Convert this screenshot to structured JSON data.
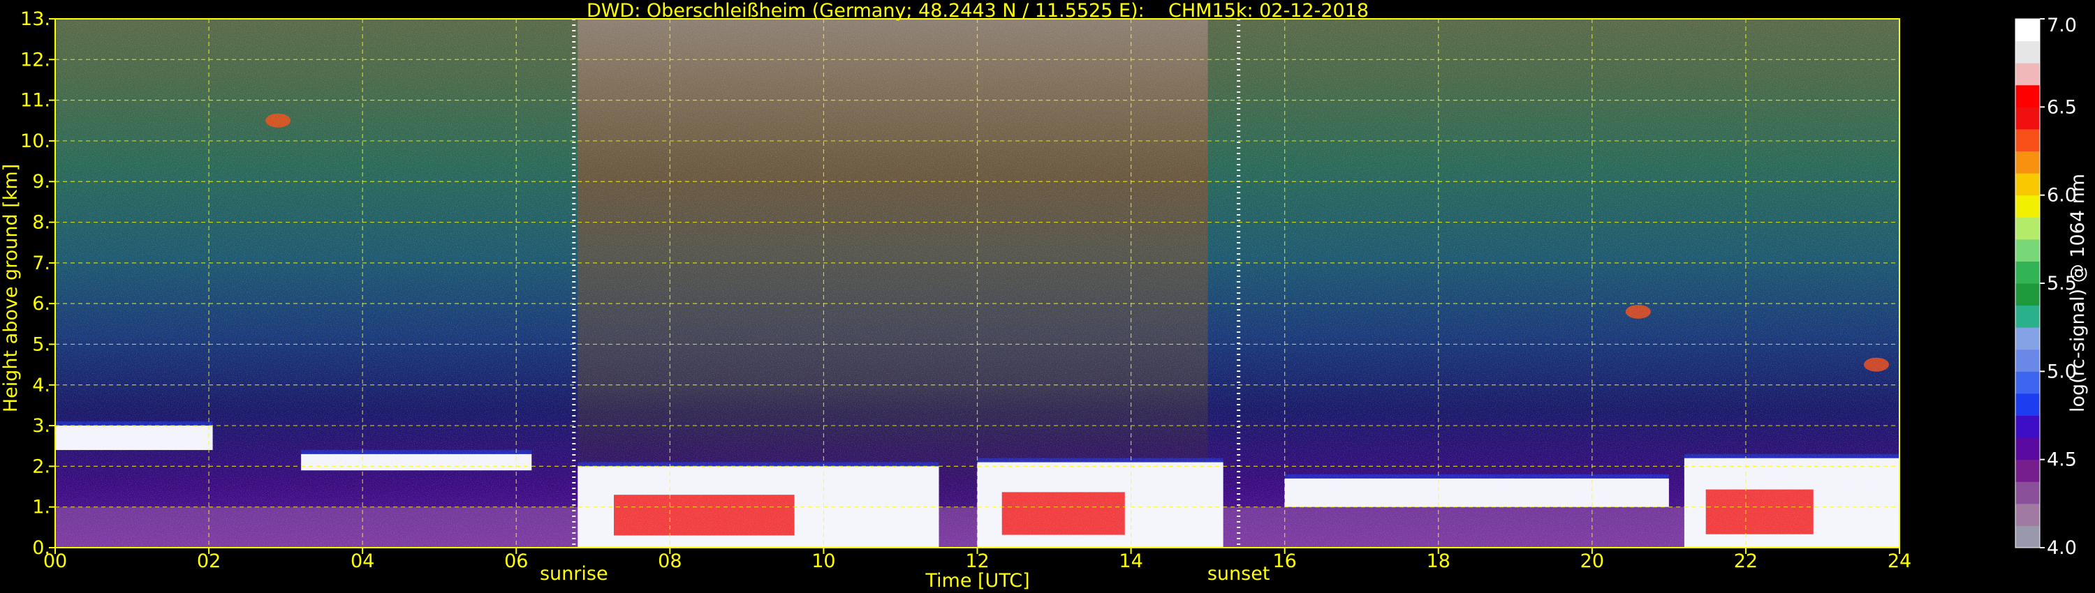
{
  "chart_data": {
    "type": "heatmap",
    "title": "DWD: Oberschleißheim (Germany; 48.2443 N / 11.5525 E):    CHM15k: 02-12-2018",
    "xlabel": "Time [UTC]",
    "ylabel": "Height above ground [km]",
    "xlim": [
      0,
      24
    ],
    "ylim": [
      0,
      13
    ],
    "x_ticks": [
      0,
      2,
      4,
      6,
      8,
      10,
      12,
      14,
      16,
      18,
      20,
      22,
      24
    ],
    "x_tick_labels": [
      "00",
      "02",
      "04",
      "06",
      "08",
      "10",
      "12",
      "14",
      "16",
      "18",
      "20",
      "22",
      "24"
    ],
    "y_ticks": [
      0,
      1,
      2,
      3,
      4,
      5,
      6,
      7,
      8,
      9,
      10,
      11,
      12,
      13
    ],
    "y_tick_labels": [
      "0.",
      "1.",
      "2.",
      "3.",
      "4.",
      "5.",
      "6.",
      "7.",
      "8.",
      "9.",
      "10.",
      "11.",
      "12.",
      "13."
    ],
    "grid": true,
    "markers": [
      {
        "label": "sunrise",
        "time": 6.75
      },
      {
        "label": "sunset",
        "time": 15.4
      }
    ],
    "colorbar": {
      "label": "log(rc-signal) @ 1064 nm",
      "range": [
        4.0,
        7.0
      ],
      "ticks": [
        4.0,
        4.5,
        5.0,
        5.5,
        6.0,
        6.5,
        7.0
      ],
      "tick_labels": [
        "4.0",
        "4.5",
        "5.0",
        "5.5",
        "6.0",
        "6.5",
        "7.0"
      ],
      "colors": [
        "#9a98ac",
        "#a07aa0",
        "#8a509a",
        "#761e8c",
        "#5a0aa0",
        "#3e0ec6",
        "#1c3ef0",
        "#3c66f0",
        "#6a88e8",
        "#86a2e6",
        "#2ab08a",
        "#1e9a3c",
        "#32b456",
        "#78d878",
        "#b4ec6a",
        "#f0f000",
        "#f8c800",
        "#f89010",
        "#f85018",
        "#f01010",
        "#ff0000",
        "#f0b8b8",
        "#e6e6e6",
        "#ffffff"
      ]
    },
    "cloud_layers": [
      {
        "t0": 0.0,
        "t1": 2.05,
        "base_km": 2.4,
        "top_km": 3.0
      },
      {
        "t0": 3.2,
        "t1": 6.2,
        "base_km": 1.9,
        "top_km": 2.3
      },
      {
        "t0": 6.8,
        "t1": 11.5,
        "base_km": 0.0,
        "top_km": 2.0
      },
      {
        "t0": 12.0,
        "t1": 15.2,
        "base_km": 0.0,
        "top_km": 2.1
      },
      {
        "t0": 16.0,
        "t1": 21.0,
        "base_km": 1.0,
        "top_km": 1.7
      },
      {
        "t0": 21.2,
        "t1": 24.0,
        "base_km": 0.0,
        "top_km": 2.2
      }
    ],
    "cirrus_patches": [
      {
        "time": 2.9,
        "height_km": 10.5
      },
      {
        "time": 20.6,
        "height_km": 5.8
      },
      {
        "time": 23.7,
        "height_km": 4.5
      }
    ]
  }
}
